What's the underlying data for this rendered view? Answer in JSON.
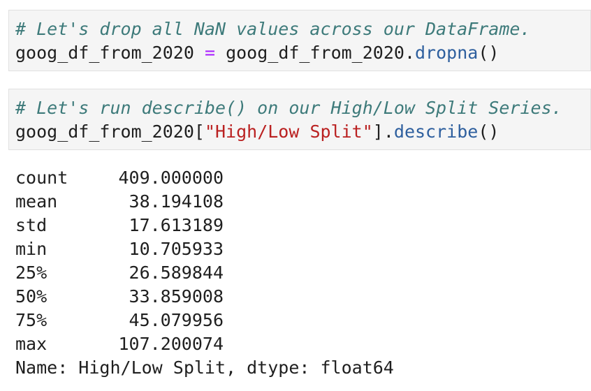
{
  "cell_1": {
    "comment": "# Let's drop all NaN values across our DataFrame.",
    "var": "goog_df_from_2020",
    "op": "=",
    "obj": "goog_df_from_2020",
    "method": "dropna",
    "args": "()"
  },
  "cell_2": {
    "comment": "# Let's run describe() on our High/Low Split Series.",
    "var": "goog_df_from_2020",
    "bracket_open": "[",
    "key": "\"High/Low Split\"",
    "bracket_close": "]",
    "method": "describe",
    "args": "()"
  },
  "output": {
    "rows": [
      {
        "label": "count",
        "value": "409.000000"
      },
      {
        "label": "mean",
        "value": "38.194108"
      },
      {
        "label": "std",
        "value": "17.613189"
      },
      {
        "label": "min",
        "value": "10.705933"
      },
      {
        "label": "25%",
        "value": "26.589844"
      },
      {
        "label": "50%",
        "value": "33.859008"
      },
      {
        "label": "75%",
        "value": "45.079956"
      },
      {
        "label": "max",
        "value": "107.200074"
      }
    ],
    "footer": "Name: High/Low Split, dtype: float64"
  },
  "colors": {
    "comment": "#3d7a7a",
    "operator": "#aa22ff",
    "method": "#2e5f9e",
    "string": "#ba2121",
    "cell_background": "#f5f5f5"
  }
}
